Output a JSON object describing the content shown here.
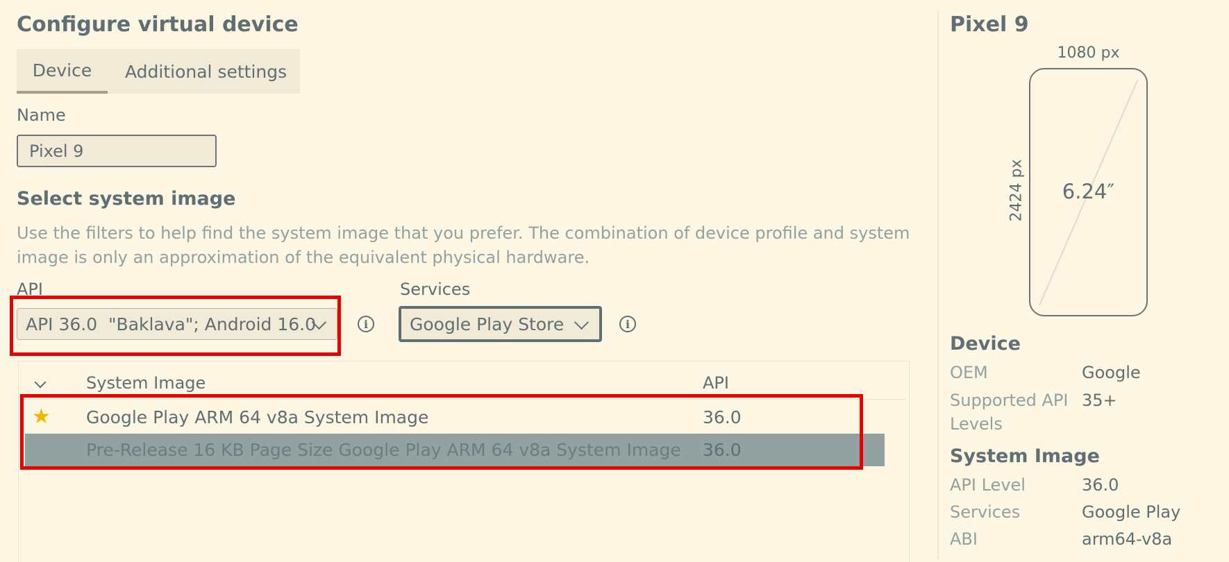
{
  "page": {
    "title": "Configure virtual device",
    "tabs": [
      {
        "label": "Device",
        "active": true
      },
      {
        "label": "Additional settings",
        "active": false
      }
    ],
    "name_label": "Name",
    "name_value": "Pixel 9",
    "section_title": "Select system image",
    "description": "Use the filters to help find the system image that you prefer. The combination of device profile and system image is only an approximation of the equivalent physical hardware.",
    "api_filter": {
      "label": "API",
      "value": "API 36.0  \"Baklava\"; Android 16.0"
    },
    "services_filter": {
      "label": "Services",
      "value": "Google Play Store"
    },
    "table": {
      "columns": {
        "system_image": "System Image",
        "api": "API"
      },
      "rows": [
        {
          "name": "Google Play ARM 64 v8a System Image",
          "api": "36.0",
          "recommended": true,
          "selected": false
        },
        {
          "name": "Pre-Release 16 KB Page Size Google Play ARM 64 v8a System Image",
          "api": "36.0",
          "recommended": false,
          "selected": true
        }
      ]
    }
  },
  "sidebar": {
    "device_name": "Pixel 9",
    "width_label": "1080 px",
    "height_label": "2424 px",
    "diagonal_label": "6.24″",
    "device_section": "Device",
    "device_props": [
      {
        "key": "OEM",
        "value": "Google"
      },
      {
        "key": "Supported API Levels",
        "value": "35+"
      }
    ],
    "image_section": "System Image",
    "image_props": [
      {
        "key": "API Level",
        "value": "36.0"
      },
      {
        "key": "Services",
        "value": "Google Play"
      },
      {
        "key": "ABI",
        "value": "arm64-v8a"
      }
    ]
  },
  "colors": {
    "background": "#fdf6e3",
    "highlight_box": "#e60000",
    "selected_row": "#93a1a1",
    "star": "#f5b400"
  },
  "icons": [
    "chevron-down-icon",
    "info-icon",
    "star-icon"
  ]
}
